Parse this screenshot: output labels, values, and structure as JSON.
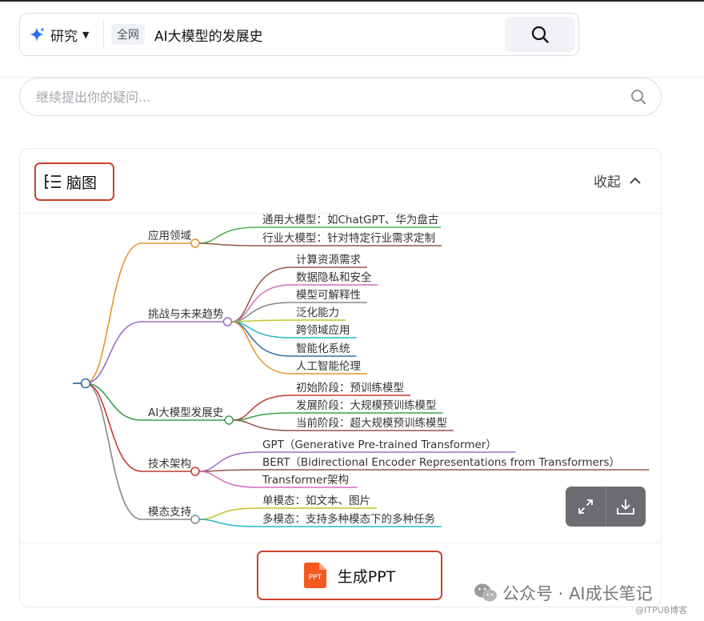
{
  "search": {
    "mode_label": "研究",
    "scope_tag": "全网",
    "query": "AI大模型的发展史"
  },
  "followup": {
    "placeholder": "继续提出你的疑问..."
  },
  "card": {
    "title": "脑图",
    "collapse_label": "收起",
    "generate_ppt_label": "生成PPT",
    "ppt_icon_text": "PPT"
  },
  "mindmap": {
    "branches": [
      {
        "label": "应用领域",
        "color": "#e8942c",
        "children": [
          {
            "label": "通用大模型：如ChatGPT、华为盘古",
            "color": "#4caf50"
          },
          {
            "label": "行业大模型：针对特定行业需求定制",
            "color": "#8d5a4a"
          }
        ]
      },
      {
        "label": "挑战与未来趋势",
        "color": "#a06ac8",
        "children": [
          {
            "label": "计算资源需求",
            "color": "#8d5a4a"
          },
          {
            "label": "数据隐私和安全",
            "color": "#d36fbf"
          },
          {
            "label": "模型可解释性",
            "color": "#888888"
          },
          {
            "label": "泛化能力",
            "color": "#c3c42b"
          },
          {
            "label": "跨领域应用",
            "color": "#29b8c9"
          },
          {
            "label": "智能化系统",
            "color": "#2f73a8"
          },
          {
            "label": "人工智能伦理",
            "color": "#e8942c"
          }
        ]
      },
      {
        "label": "AI大模型发展史",
        "color": "#3aa04a",
        "children": [
          {
            "label": "初始阶段：预训练模型",
            "color": "#c7392f"
          },
          {
            "label": "发展阶段：大规模预训练模型",
            "color": "#3aa04a"
          },
          {
            "label": "当前阶段：超大规模预训练模型",
            "color": "#8d5a4a"
          }
        ]
      },
      {
        "label": "技术架构",
        "color": "#c7392f",
        "children": [
          {
            "label": "GPT（Generative Pre-trained Transformer）",
            "color": "#a06ac8"
          },
          {
            "label": "BERT（Bidirectional Encoder Representations from Transformers）",
            "color": "#8d5a4a"
          },
          {
            "label": "Transformer架构",
            "color": "#d36fbf"
          }
        ]
      },
      {
        "label": "模态支持",
        "color": "#888888",
        "children": [
          {
            "label": "单模态：如文本、图片",
            "color": "#c3c42b"
          },
          {
            "label": "多模态：支持多种模态下的多种任务",
            "color": "#29b8c9"
          }
        ]
      }
    ]
  },
  "watermark": {
    "text": "公众号 · AI成长笔记",
    "sub": "@ITPUB博客"
  },
  "colors": {
    "accent_border": "#c9432b",
    "ppt_orange": "#f25a1f",
    "star_blue": "#2b6ef2"
  }
}
